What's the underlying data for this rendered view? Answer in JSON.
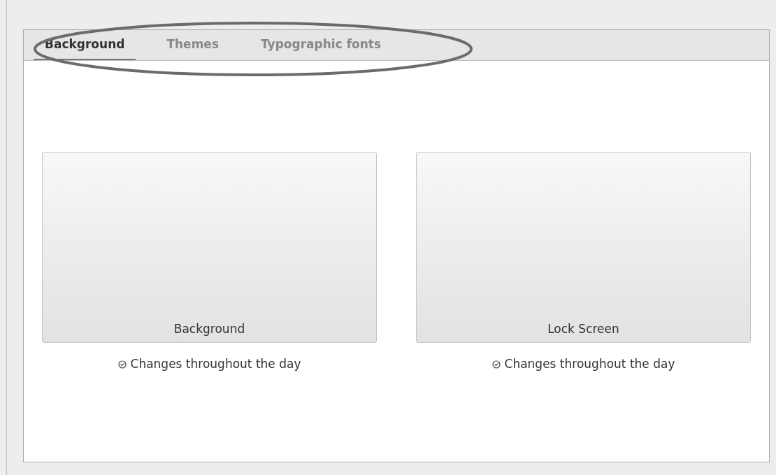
{
  "tabs": [
    {
      "label": "Background",
      "selected": true
    },
    {
      "label": "Themes",
      "selected": false
    },
    {
      "label": "Typographic fonts",
      "selected": false
    }
  ],
  "previews": [
    {
      "label": "Background",
      "schedule": "Changes throughout the day"
    },
    {
      "label": "Lock Screen",
      "schedule": "Changes throughout the day"
    }
  ]
}
